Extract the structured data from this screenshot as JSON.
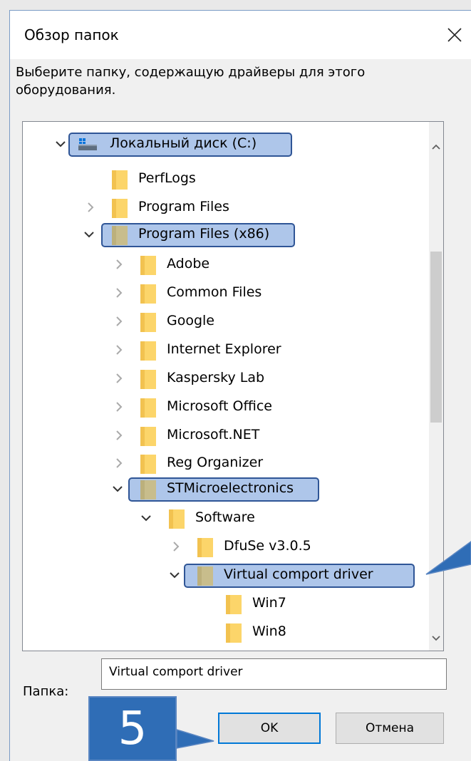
{
  "dialog": {
    "title": "Обзор папок",
    "description": "Выберите папку, содержащую драйверы для этого оборудования.",
    "folder_label": "Папка:",
    "folder_value": "Virtual comport driver",
    "ok_label": "OK",
    "cancel_label": "Отмена"
  },
  "tree": {
    "items": [
      {
        "label": "Локальный диск (C:)"
      },
      {
        "label": "PerfLogs"
      },
      {
        "label": "Program Files"
      },
      {
        "label": "Program Files (x86)"
      },
      {
        "label": "Adobe"
      },
      {
        "label": "Common Files"
      },
      {
        "label": "Google"
      },
      {
        "label": "Internet Explorer"
      },
      {
        "label": "Kaspersky Lab"
      },
      {
        "label": "Microsoft Office"
      },
      {
        "label": "Microsoft.NET"
      },
      {
        "label": "Reg Organizer"
      },
      {
        "label": "STMicroelectronics"
      },
      {
        "label": "Software"
      },
      {
        "label": "DfuSe v3.0.5"
      },
      {
        "label": "Virtual comport driver"
      },
      {
        "label": "Win7"
      },
      {
        "label": "Win8"
      }
    ]
  },
  "annotation": {
    "step_number": "5"
  },
  "colors": {
    "highlight_fill": "#aec6ea",
    "highlight_border": "#2f5596",
    "callout": "#2f6db6",
    "folder": "#fcd56a",
    "folder_selected": "#c8bd8c"
  }
}
